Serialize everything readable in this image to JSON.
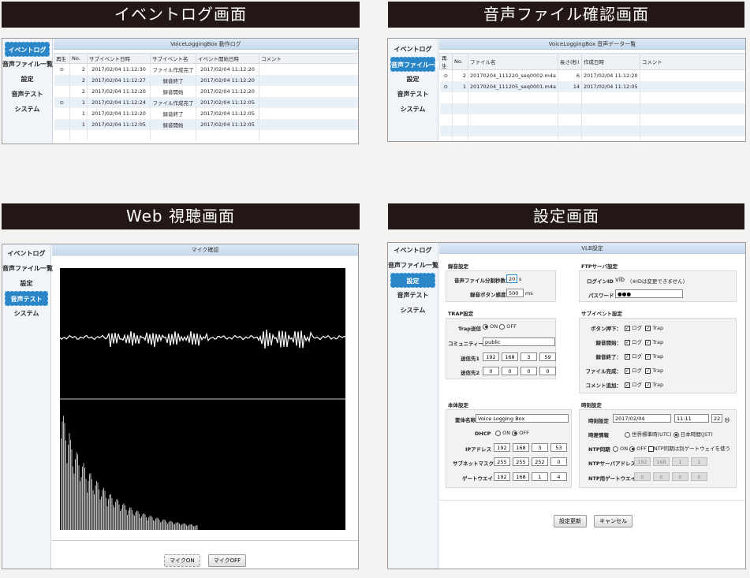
{
  "panels": {
    "event": {
      "title": "イベントログ画面",
      "header": "VoiceLoggingBox 動作ログ",
      "columns": [
        "再生",
        "No.",
        "サブイベント日時",
        "サブイベント名",
        "イベント開始日時",
        "コメント"
      ],
      "rows": [
        {
          "play": "⊙",
          "no": "2",
          "sub_time": "2017/02/04 11:12:30",
          "sub_name": "ファイル作成完了",
          "start": "2017/02/04 11:12:20"
        },
        {
          "play": "",
          "no": "2",
          "sub_time": "2017/02/04 11:12:27",
          "sub_name": "録音終了",
          "start": "2017/02/04 11:12:20"
        },
        {
          "play": "",
          "no": "2",
          "sub_time": "2017/02/04 11:12:20",
          "sub_name": "録音開始",
          "start": "2017/02/04 11:12:20"
        },
        {
          "play": "⊙",
          "no": "1",
          "sub_time": "2017/02/04 11:12:24",
          "sub_name": "ファイル作成完了",
          "start": "2017/02/04 11:12:05"
        },
        {
          "play": "",
          "no": "1",
          "sub_time": "2017/02/04 11:12:20",
          "sub_name": "録音終了",
          "start": "2017/02/04 11:12:05"
        },
        {
          "play": "",
          "no": "1",
          "sub_time": "2017/02/04 11:12:05",
          "sub_name": "録音開始",
          "start": "2017/02/04 11:12:05"
        }
      ]
    },
    "files": {
      "title": "音声ファイル確認画面",
      "header": "VoiceLoggingBox 音声データ一覧",
      "columns": [
        "再生",
        "No.",
        "ファイル名",
        "長さ(秒)",
        "作成日時",
        "コメント"
      ],
      "rows": [
        {
          "play": "⊙",
          "no": "2",
          "name": "20170204_111220_seq0002.m4a",
          "len": "6",
          "created": "2017/02/04 11:12:20"
        },
        {
          "play": "⊙",
          "no": "1",
          "name": "20170204_111205_seq0001.m4a",
          "len": "14",
          "created": "2017/02/04 11:12:05"
        }
      ]
    },
    "web": {
      "title": "Web 視聴画面",
      "header": "マイク確認",
      "mic_on": "マイクON",
      "mic_off": "マイクOFF"
    },
    "settings": {
      "title": "設定画面",
      "header": "VLB設定"
    }
  },
  "sidebar": [
    "イベントログ",
    "音声ファイル一覧",
    "設定",
    "音声テスト",
    "システム"
  ],
  "rec": {
    "title": "録音設定",
    "file_len_label": "音声ファイル分割秒数",
    "file_len": "20",
    "unit_s": "s",
    "btn_label": "録音ボタン感度",
    "btn": "500",
    "unit_ms": "ms"
  },
  "ftp": {
    "title": "FTPサーバ設定",
    "id_label": "ログインID",
    "id": "vlb",
    "id_note": "（※IDは変更できません）",
    "pw_label": "パスワード",
    "pw": "●●●"
  },
  "trap": {
    "title": "TRAP設定",
    "send_label": "Trap送信",
    "on": "ON",
    "off": "OFF",
    "comm_label": "コミュニティー",
    "comm": "public",
    "dest1_label": "送信先1",
    "dest1": [
      "192",
      "168",
      "3",
      "59"
    ],
    "dest2_label": "送信先2",
    "dest2": [
      "0",
      "0",
      "0",
      "0"
    ]
  },
  "subevt": {
    "title": "サブイベント設定",
    "log": "ログ",
    "trap": "Trap",
    "items": [
      "ボタン押下：",
      "録音開始：",
      "録音終了：",
      "ファイル完成：",
      "コメント追加："
    ]
  },
  "body_set": {
    "title": "本体設定",
    "name_label": "筐体名称",
    "name": "Voice Logging Box",
    "dhcp_label": "DHCP",
    "on": "ON",
    "off": "OFF",
    "ip_label": "IPアドレス",
    "ip": [
      "192",
      "168",
      "3",
      "53"
    ],
    "mask_label": "サブネットマスク",
    "mask": [
      "255",
      "255",
      "252",
      "0"
    ],
    "gw_label": "ゲートウエイ",
    "gw": [
      "192",
      "168",
      "1",
      "4"
    ]
  },
  "time_set": {
    "title": "時刻設定",
    "clock_label": "時刻設定",
    "date": "2017/02/04",
    "time": "11:11",
    "sec": "22",
    "sec_unit": "秒",
    "zone_label": "時差情報",
    "utc": "世界標準時(UTC)",
    "jst": "日本時間(JST)",
    "ntp_label": "NTP同期",
    "on": "ON",
    "off": "OFF",
    "ntp_note": "NTP同期は別ゲートウェイを使う",
    "ntp_addr_label": "NTPサーバアドレス",
    "ntp_addr": [
      "192",
      "168",
      "1",
      "1"
    ],
    "ntp_gw_label": "NTP用ゲートウエイ",
    "ntp_gw": [
      "0",
      "0",
      "0",
      "0"
    ]
  },
  "buttons": {
    "update": "設定更新",
    "cancel": "キャンセル"
  }
}
